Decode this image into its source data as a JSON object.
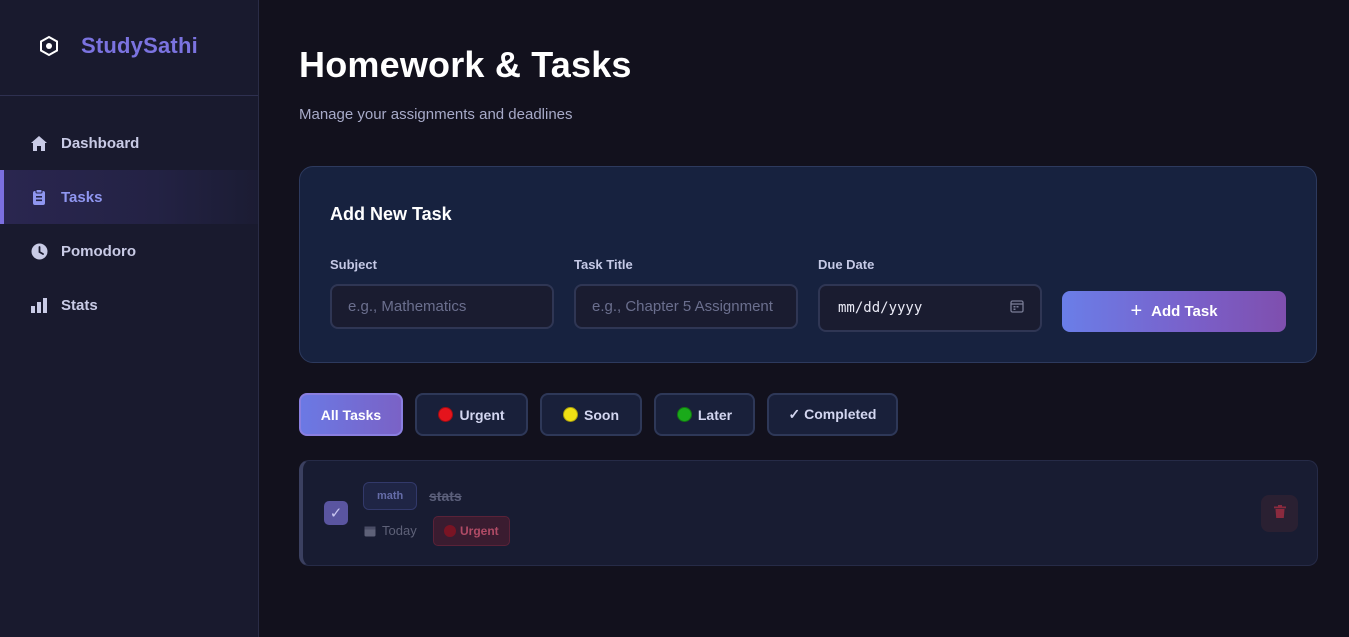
{
  "sidebar": {
    "brand": "StudySathi",
    "items": [
      {
        "label": "Dashboard",
        "icon": "home-icon"
      },
      {
        "label": "Tasks",
        "icon": "clipboard-icon",
        "active": true
      },
      {
        "label": "Pomodoro",
        "icon": "clock-icon"
      },
      {
        "label": "Stats",
        "icon": "bar-chart-icon"
      }
    ]
  },
  "header": {
    "title": "Homework & Tasks",
    "subtitle": "Manage your assignments and deadlines"
  },
  "form": {
    "title": "Add New Task",
    "subject_label": "Subject",
    "subject_placeholder": "e.g., Mathematics",
    "task_label": "Task Title",
    "task_placeholder": "e.g., Chapter 5 Assignment",
    "date_label": "Due Date",
    "date_placeholder": "mm/dd/yyyy",
    "add_button": "Add Task"
  },
  "filters": [
    {
      "label": "All Tasks",
      "active": true
    },
    {
      "label": "Urgent",
      "dot": "#e5141c"
    },
    {
      "label": "Soon",
      "dot": "#f0e014"
    },
    {
      "label": "Later",
      "dot": "#1aaa1a"
    },
    {
      "label": "✓ Completed"
    }
  ],
  "tasks": [
    {
      "subject": "math",
      "title": "stats",
      "due": "Today",
      "priority": "Urgent",
      "completed": true
    }
  ],
  "colors": {
    "accent": "#7b73e0",
    "background": "#12111d",
    "sidebar": "#191a2e",
    "card": "#17223f"
  }
}
